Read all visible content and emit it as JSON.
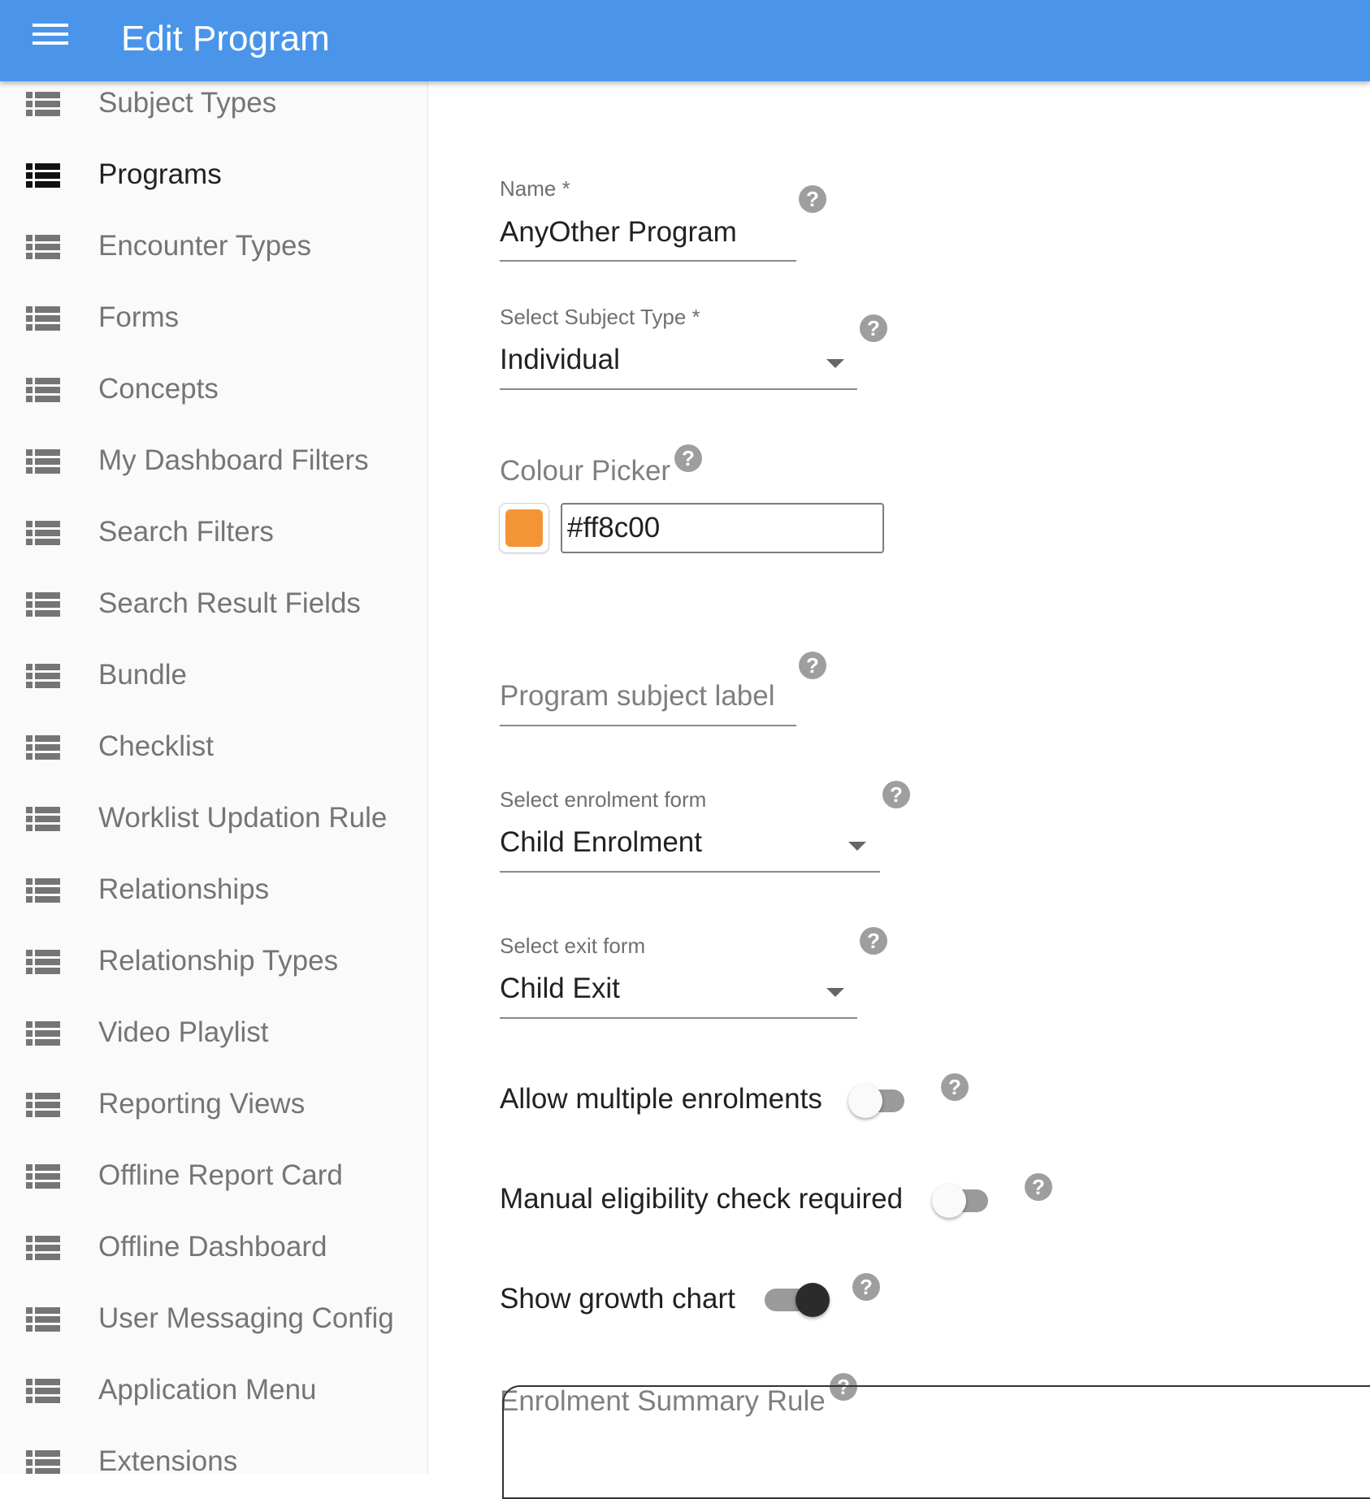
{
  "appbar": {
    "title": "Edit Program",
    "menu_icon": "menu-icon",
    "color": "#4a95ea"
  },
  "sidebar": {
    "active_index": 1,
    "items": [
      {
        "label": "Subject Types"
      },
      {
        "label": "Programs"
      },
      {
        "label": "Encounter Types"
      },
      {
        "label": "Forms"
      },
      {
        "label": "Concepts"
      },
      {
        "label": "My Dashboard Filters"
      },
      {
        "label": "Search Filters"
      },
      {
        "label": "Search Result Fields"
      },
      {
        "label": "Bundle"
      },
      {
        "label": "Checklist"
      },
      {
        "label": "Worklist Updation Rule"
      },
      {
        "label": "Relationships"
      },
      {
        "label": "Relationship Types"
      },
      {
        "label": "Video Playlist"
      },
      {
        "label": "Reporting Views"
      },
      {
        "label": "Offline Report Card"
      },
      {
        "label": "Offline Dashboard"
      },
      {
        "label": "User Messaging Config"
      },
      {
        "label": "Application Menu"
      },
      {
        "label": "Extensions"
      }
    ],
    "item_icon": "list-icon"
  },
  "form": {
    "name": {
      "label": "Name *",
      "value": "AnyOther Program"
    },
    "subject_type": {
      "label": "Select Subject Type *",
      "value": "Individual"
    },
    "colour_picker": {
      "label": "Colour Picker",
      "value": "#ff8c00",
      "swatch_color": "#f39436"
    },
    "program_subject_label": {
      "placeholder": "Program subject label",
      "value": ""
    },
    "enrolment_form": {
      "label": "Select enrolment form",
      "value": "Child Enrolment"
    },
    "exit_form": {
      "label": "Select exit form",
      "value": "Child Exit"
    },
    "allow_multiple_enrolments": {
      "label": "Allow multiple enrolments",
      "checked": false
    },
    "manual_eligibility": {
      "label": "Manual eligibility check required",
      "checked": false
    },
    "show_growth_chart": {
      "label": "Show growth chart",
      "checked": true
    },
    "enrolment_summary_rule": {
      "label": "Enrolment Summary Rule"
    },
    "help_icon": "help-icon",
    "help_glyph": "?"
  }
}
